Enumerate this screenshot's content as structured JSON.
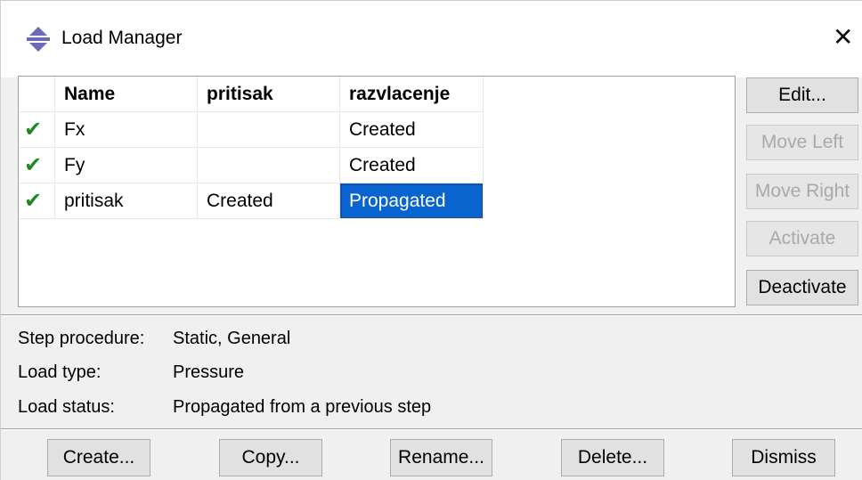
{
  "window": {
    "title": "Load Manager",
    "icon": "load-manager-icon",
    "close_symbol": "✕"
  },
  "table": {
    "columns": [
      "",
      "Name",
      "pritisak",
      "razvlacenje"
    ],
    "rows": [
      {
        "check": "✔",
        "name": "Fx",
        "pritisak": "",
        "razvlacenje": "Created"
      },
      {
        "check": "✔",
        "name": "Fy",
        "pritisak": "",
        "razvlacenje": "Created"
      },
      {
        "check": "✔",
        "name": "pritisak",
        "pritisak": "Created",
        "razvlacenje": "Propagated"
      }
    ],
    "selected_cell": {
      "row": 2,
      "column": "razvlacenje"
    }
  },
  "side_buttons": {
    "edit": "Edit...",
    "move_left": "Move Left",
    "move_right": "Move Right",
    "activate": "Activate",
    "deactivate": "Deactivate"
  },
  "info": {
    "procedure_label": "Step procedure:",
    "procedure_value": "Static, General",
    "type_label": "Load type:",
    "type_value": "Pressure",
    "status_label": "Load status:",
    "status_value": "Propagated from a previous step"
  },
  "bottom_buttons": {
    "create": "Create...",
    "copy": "Copy...",
    "rename": "Rename...",
    "delete": "Delete...",
    "dismiss": "Dismiss"
  },
  "colors": {
    "check": "#1f8a1f",
    "selection": "#0a64d0",
    "disabled_text": "#a9a9a9"
  }
}
